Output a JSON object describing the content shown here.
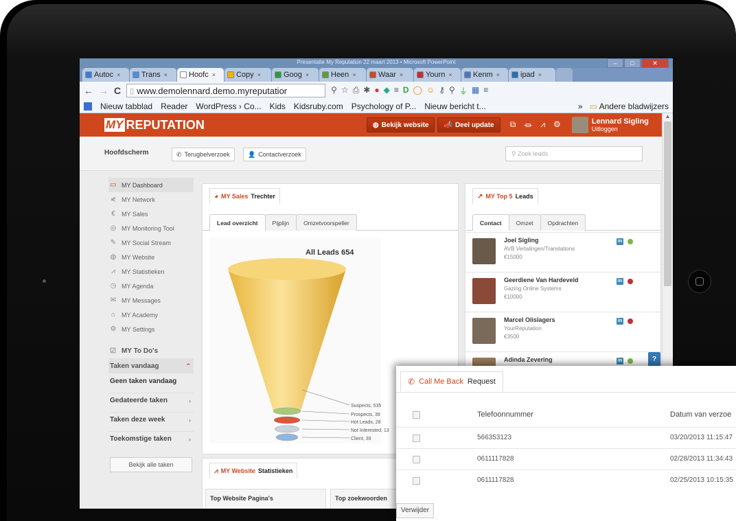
{
  "browser": {
    "window_title": "Presentatie My Reputation 22 maart 2013 • Microsoft PowerPoint",
    "tabs": [
      {
        "label": "Autoc",
        "color": "#3b7dd8"
      },
      {
        "label": "Trans",
        "color": "#4a90d9"
      },
      {
        "label": "Hoofc",
        "color": "#ffffff",
        "active": true
      },
      {
        "label": "Copy",
        "color": "#f0b400"
      },
      {
        "label": "Goog",
        "color": "#2e9b3a"
      },
      {
        "label": "Heen",
        "color": "#5a9e3d"
      },
      {
        "label": "Waar",
        "color": "#c94b2a"
      },
      {
        "label": "Yourn",
        "color": "#c0303a"
      },
      {
        "label": "Kenm",
        "color": "#4a7ab8"
      },
      {
        "label": "ipad",
        "color": "#2a6fb0"
      }
    ],
    "tab_close": "×",
    "url": "www.demolennard.demo.myreputatior",
    "bookmarks": [
      "Nieuw tabblad",
      "Reader",
      "WordPress › Co...",
      "Kids",
      "Kidsruby.com",
      "Psychology of P...",
      "Nieuw bericht t..."
    ],
    "bookmarks_more": "»",
    "other_bookmarks": "Andere bladwijzers"
  },
  "header": {
    "logo_my": "MY",
    "logo_text": "REPUTATION",
    "view_website": "Bekijk website",
    "share_update": "Deel update",
    "user_name": "Lennard Sigling",
    "logout": "Uitloggen"
  },
  "subnav": {
    "home": "Hoofdscherm",
    "callback": "Terugbelverzoek",
    "contact": "Contactverzoek",
    "search_placeholder": "Zoek leads"
  },
  "sidebar": {
    "items": [
      {
        "label": "MY Dashboard",
        "icon": "monitor-icon"
      },
      {
        "label": "MY Network",
        "icon": "network-icon"
      },
      {
        "label": "MY Sales",
        "icon": "euro-icon"
      },
      {
        "label": "MY Monitoring Tool",
        "icon": "monitoring-icon"
      },
      {
        "label": "MY Social Stream",
        "icon": "chat-icon"
      },
      {
        "label": "MY Website",
        "icon": "globe-icon"
      },
      {
        "label": "MY Statistieken",
        "icon": "chart-icon"
      },
      {
        "label": "MY Agenda",
        "icon": "clock-icon"
      },
      {
        "label": "MY Messages",
        "icon": "mail-icon"
      },
      {
        "label": "MY Academy",
        "icon": "academy-icon"
      },
      {
        "label": "MY Settings",
        "icon": "gear-icon"
      }
    ],
    "todo_title": "MY To Do's",
    "tasks": [
      {
        "label": "Taken vandaag"
      },
      {
        "label": "Geen taken vandaag"
      },
      {
        "label": "Gedateerde taken"
      },
      {
        "label": "Taken deze week"
      },
      {
        "label": "Toekomstige taken"
      }
    ],
    "all_tasks": "Bekijk alle taken"
  },
  "sales": {
    "title_red": "MY Sales",
    "title_rest": "Trechter",
    "tabs": [
      "Lead overzicht",
      "Pijplijn",
      "Omzetvoorspeller"
    ],
    "funnel_title": "All Leads 654"
  },
  "chart_data": {
    "type": "funnel",
    "title": "All Leads 654",
    "categories": [
      "Suspects",
      "Prospects",
      "Hot Leads",
      "Not Interested",
      "Client"
    ],
    "values": [
      535,
      39,
      28,
      13,
      39
    ],
    "labels": [
      "Suspects, 535",
      "Prospects, 39",
      "Hot Leads, 28",
      "Not Interested, 13",
      "Client, 39"
    ],
    "colors": [
      "#f0c24d",
      "#a8c97a",
      "#d9573a",
      "#c9d3e0",
      "#8fb8df"
    ]
  },
  "website_stats": {
    "title_red": "MY Website",
    "title_rest": "Statistieken",
    "top_pages": "Top Website Pagina's",
    "top_keywords": "Top zoekwoorden"
  },
  "top_leads": {
    "title_red": "MY Top 5",
    "title_rest": "Leads",
    "tabs": [
      "Contact",
      "Omzet",
      "Opdrachten"
    ],
    "linkedin": "in",
    "leads": [
      {
        "name": "Joel Sigling",
        "company": "AVB Vertalingen/Translations",
        "value": "€15000",
        "status_color": "#7ab648"
      },
      {
        "name": "Geerdiene Van Hardeveld",
        "company": "Gazing Online Systems",
        "value": "€10000",
        "status_color": "#c0303a"
      },
      {
        "name": "Marcel Olislagers",
        "company": "YourReputation",
        "value": "€3500",
        "status_color": "#c0303a"
      },
      {
        "name": "Adinda Zevering",
        "company": "",
        "value": "",
        "status_color": "#7ab648"
      }
    ]
  },
  "help": "?",
  "callback_popup": {
    "title_red": "Call Me Back",
    "title_rest": "Request",
    "col_phone": "Telefoonnummer",
    "col_date": "Datum van verzoe",
    "rows": [
      {
        "phone": "566353123",
        "date": "03/20/2013 11:15:47"
      },
      {
        "phone": "0611117828",
        "date": "02/28/2013 11:34:43"
      },
      {
        "phone": "0611117828",
        "date": "02/25/2013 10:15:35"
      }
    ],
    "delete": "Verwijder"
  }
}
